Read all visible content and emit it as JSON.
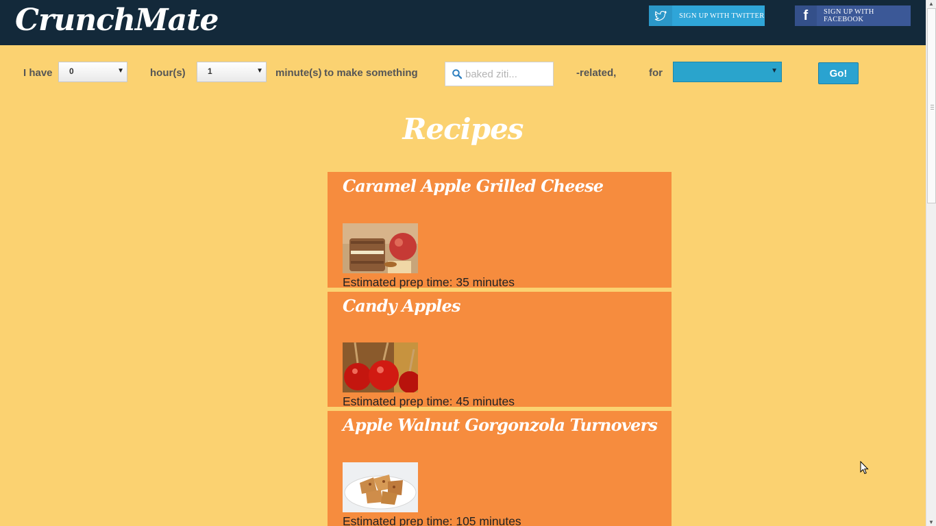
{
  "header": {
    "logo": "CrunchMate",
    "twitter_label": "Sign up with Twitter",
    "facebook_label": "Sign up with Facebook"
  },
  "form": {
    "i_have": "I have",
    "hours_value": "0",
    "hours_label": "hour(s)",
    "minutes_value": "1",
    "minutes_label": "minute(s)",
    "make_label": "to make something",
    "search_placeholder": "baked ziti...",
    "related_label": "-related,",
    "for_label": "for",
    "for_value": "",
    "go_label": "Go!"
  },
  "heading": "Recipes",
  "recipes": [
    {
      "title": "Caramel Apple Grilled Cheese",
      "prep": "Estimated prep time: 35 minutes"
    },
    {
      "title": "Candy Apples",
      "prep": "Estimated prep time: 45 minutes"
    },
    {
      "title": "Apple Walnut Gorgonzola Turnovers",
      "prep": "Estimated prep time: 105 minutes"
    }
  ],
  "colors": {
    "background": "#fbd271",
    "topbar": "#13293a",
    "card": "#f68c3e",
    "accent": "#2aa4cc"
  }
}
